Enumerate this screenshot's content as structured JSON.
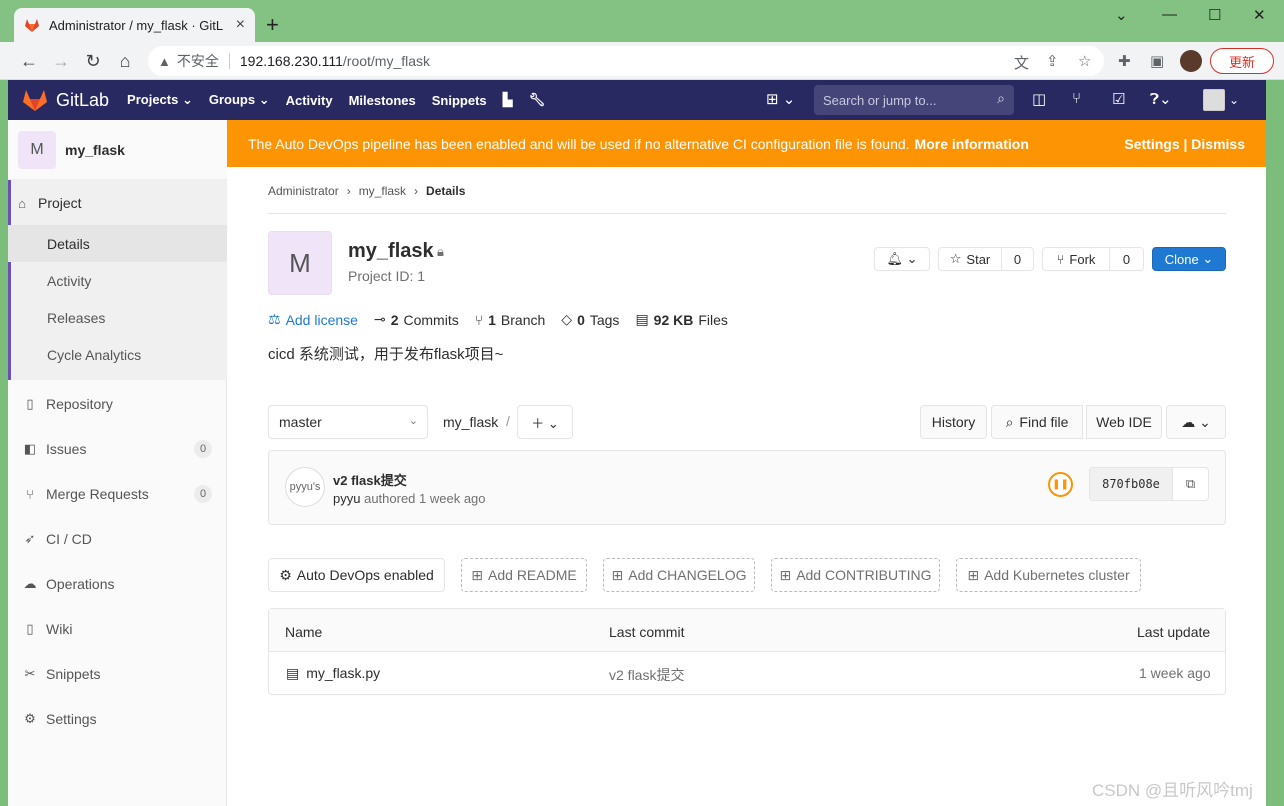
{
  "browser": {
    "tab_title": "Administrator / my_flask · GitL",
    "tab_close": "×",
    "new_tab": "+",
    "security": "不安全",
    "url_host": "192.168.230.111",
    "url_path": "/root/my_flask",
    "update_label": "更新"
  },
  "gitlab_nav": {
    "brand": "GitLab",
    "items": [
      "Projects ⌄",
      "Groups ⌄",
      "Activity",
      "Milestones",
      "Snippets"
    ],
    "search_placeholder": "Search or jump to..."
  },
  "sidebar": {
    "avatar_letter": "M",
    "project_name": "my_flask",
    "project_label": "Project",
    "sub_items": [
      "Details",
      "Activity",
      "Releases",
      "Cycle Analytics"
    ],
    "items": [
      {
        "label": "Repository",
        "icon": "book-icon"
      },
      {
        "label": "Issues",
        "icon": "issues-icon",
        "count": "0"
      },
      {
        "label": "Merge Requests",
        "icon": "merge-request-icon",
        "count": "0"
      },
      {
        "label": "CI / CD",
        "icon": "rocket-icon"
      },
      {
        "label": "Operations",
        "icon": "cloud-gear-icon"
      },
      {
        "label": "Wiki",
        "icon": "book-icon"
      },
      {
        "label": "Snippets",
        "icon": "scissors-icon"
      },
      {
        "label": "Settings",
        "icon": "gear-icon"
      }
    ]
  },
  "banner": {
    "text": "The Auto DevOps pipeline has been enabled and will be used if no alternative CI configuration file is found.",
    "link": "More information",
    "settings": "Settings | Dismiss"
  },
  "breadcrumb": {
    "items": [
      "Administrator",
      "my_flask"
    ],
    "current": "Details"
  },
  "project": {
    "avatar_letter": "M",
    "name": "my_flask",
    "id_text": "Project ID: 1",
    "star_label": "Star",
    "star_count": "0",
    "fork_label": "Fork",
    "fork_count": "0",
    "clone_label": "Clone",
    "add_license": "Add license",
    "commits_count": "2",
    "commits_label": "Commits",
    "branch_count": "1",
    "branch_label": "Branch",
    "tags_count": "0",
    "tags_label": "Tags",
    "files_size": "92 KB",
    "files_label": "Files",
    "description": "cicd 系统测试，用于发布flask项目~"
  },
  "repo_bar": {
    "branch": "master",
    "path": "my_flask",
    "path_sep": "/",
    "history": "History",
    "find_file": "Find file",
    "web_ide": "Web IDE"
  },
  "last_commit": {
    "avatar_alt": "pyyu's",
    "title": "v2 flask提交",
    "author": "pyyu",
    "authored": "authored 1 week ago",
    "sha": "870fb08e"
  },
  "quick_actions": {
    "auto_devops": "Auto DevOps enabled",
    "add_readme": "Add README",
    "add_changelog": "Add CHANGELOG",
    "add_contributing": "Add CONTRIBUTING",
    "add_k8s": "Add Kubernetes cluster"
  },
  "file_table": {
    "headers": {
      "name": "Name",
      "last_commit": "Last commit",
      "last_update": "Last update"
    },
    "rows": [
      {
        "name": "my_flask.py",
        "commit": "v2 flask提交",
        "updated": "1 week ago"
      }
    ]
  },
  "watermark": "CSDN @且听风吟tmj",
  "colors": {
    "nav": "#292961",
    "banner": "#fc9403",
    "primary": "#1f78d1"
  }
}
